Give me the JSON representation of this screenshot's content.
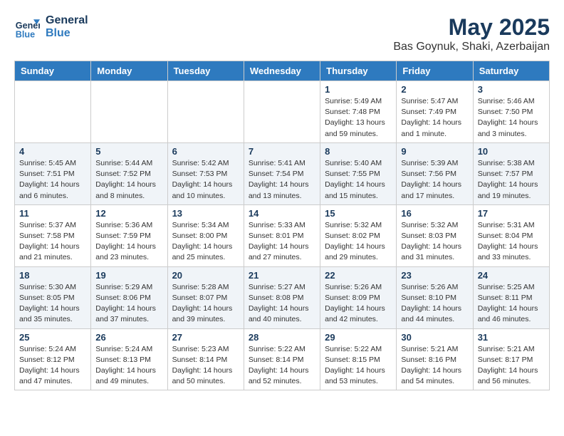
{
  "logo": {
    "line1": "General",
    "line2": "Blue"
  },
  "title": "May 2025",
  "location": "Bas Goynuk, Shaki, Azerbaijan",
  "weekdays": [
    "Sunday",
    "Monday",
    "Tuesday",
    "Wednesday",
    "Thursday",
    "Friday",
    "Saturday"
  ],
  "weeks": [
    [
      {
        "day": "",
        "info": ""
      },
      {
        "day": "",
        "info": ""
      },
      {
        "day": "",
        "info": ""
      },
      {
        "day": "",
        "info": ""
      },
      {
        "day": "1",
        "info": "Sunrise: 5:49 AM\nSunset: 7:48 PM\nDaylight: 13 hours\nand 59 minutes."
      },
      {
        "day": "2",
        "info": "Sunrise: 5:47 AM\nSunset: 7:49 PM\nDaylight: 14 hours\nand 1 minute."
      },
      {
        "day": "3",
        "info": "Sunrise: 5:46 AM\nSunset: 7:50 PM\nDaylight: 14 hours\nand 3 minutes."
      }
    ],
    [
      {
        "day": "4",
        "info": "Sunrise: 5:45 AM\nSunset: 7:51 PM\nDaylight: 14 hours\nand 6 minutes."
      },
      {
        "day": "5",
        "info": "Sunrise: 5:44 AM\nSunset: 7:52 PM\nDaylight: 14 hours\nand 8 minutes."
      },
      {
        "day": "6",
        "info": "Sunrise: 5:42 AM\nSunset: 7:53 PM\nDaylight: 14 hours\nand 10 minutes."
      },
      {
        "day": "7",
        "info": "Sunrise: 5:41 AM\nSunset: 7:54 PM\nDaylight: 14 hours\nand 13 minutes."
      },
      {
        "day": "8",
        "info": "Sunrise: 5:40 AM\nSunset: 7:55 PM\nDaylight: 14 hours\nand 15 minutes."
      },
      {
        "day": "9",
        "info": "Sunrise: 5:39 AM\nSunset: 7:56 PM\nDaylight: 14 hours\nand 17 minutes."
      },
      {
        "day": "10",
        "info": "Sunrise: 5:38 AM\nSunset: 7:57 PM\nDaylight: 14 hours\nand 19 minutes."
      }
    ],
    [
      {
        "day": "11",
        "info": "Sunrise: 5:37 AM\nSunset: 7:58 PM\nDaylight: 14 hours\nand 21 minutes."
      },
      {
        "day": "12",
        "info": "Sunrise: 5:36 AM\nSunset: 7:59 PM\nDaylight: 14 hours\nand 23 minutes."
      },
      {
        "day": "13",
        "info": "Sunrise: 5:34 AM\nSunset: 8:00 PM\nDaylight: 14 hours\nand 25 minutes."
      },
      {
        "day": "14",
        "info": "Sunrise: 5:33 AM\nSunset: 8:01 PM\nDaylight: 14 hours\nand 27 minutes."
      },
      {
        "day": "15",
        "info": "Sunrise: 5:32 AM\nSunset: 8:02 PM\nDaylight: 14 hours\nand 29 minutes."
      },
      {
        "day": "16",
        "info": "Sunrise: 5:32 AM\nSunset: 8:03 PM\nDaylight: 14 hours\nand 31 minutes."
      },
      {
        "day": "17",
        "info": "Sunrise: 5:31 AM\nSunset: 8:04 PM\nDaylight: 14 hours\nand 33 minutes."
      }
    ],
    [
      {
        "day": "18",
        "info": "Sunrise: 5:30 AM\nSunset: 8:05 PM\nDaylight: 14 hours\nand 35 minutes."
      },
      {
        "day": "19",
        "info": "Sunrise: 5:29 AM\nSunset: 8:06 PM\nDaylight: 14 hours\nand 37 minutes."
      },
      {
        "day": "20",
        "info": "Sunrise: 5:28 AM\nSunset: 8:07 PM\nDaylight: 14 hours\nand 39 minutes."
      },
      {
        "day": "21",
        "info": "Sunrise: 5:27 AM\nSunset: 8:08 PM\nDaylight: 14 hours\nand 40 minutes."
      },
      {
        "day": "22",
        "info": "Sunrise: 5:26 AM\nSunset: 8:09 PM\nDaylight: 14 hours\nand 42 minutes."
      },
      {
        "day": "23",
        "info": "Sunrise: 5:26 AM\nSunset: 8:10 PM\nDaylight: 14 hours\nand 44 minutes."
      },
      {
        "day": "24",
        "info": "Sunrise: 5:25 AM\nSunset: 8:11 PM\nDaylight: 14 hours\nand 46 minutes."
      }
    ],
    [
      {
        "day": "25",
        "info": "Sunrise: 5:24 AM\nSunset: 8:12 PM\nDaylight: 14 hours\nand 47 minutes."
      },
      {
        "day": "26",
        "info": "Sunrise: 5:24 AM\nSunset: 8:13 PM\nDaylight: 14 hours\nand 49 minutes."
      },
      {
        "day": "27",
        "info": "Sunrise: 5:23 AM\nSunset: 8:14 PM\nDaylight: 14 hours\nand 50 minutes."
      },
      {
        "day": "28",
        "info": "Sunrise: 5:22 AM\nSunset: 8:14 PM\nDaylight: 14 hours\nand 52 minutes."
      },
      {
        "day": "29",
        "info": "Sunrise: 5:22 AM\nSunset: 8:15 PM\nDaylight: 14 hours\nand 53 minutes."
      },
      {
        "day": "30",
        "info": "Sunrise: 5:21 AM\nSunset: 8:16 PM\nDaylight: 14 hours\nand 54 minutes."
      },
      {
        "day": "31",
        "info": "Sunrise: 5:21 AM\nSunset: 8:17 PM\nDaylight: 14 hours\nand 56 minutes."
      }
    ]
  ]
}
